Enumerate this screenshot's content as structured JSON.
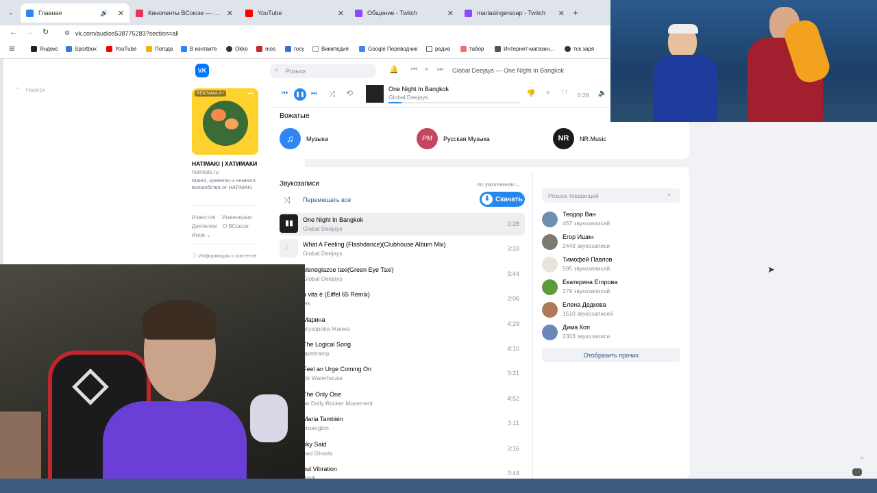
{
  "browser": {
    "tabs": [
      {
        "title": "Главная",
        "color": "#2787f5"
      },
      {
        "title": "Киноленты ВСоюзе — смотр…",
        "color": "#e8345c"
      },
      {
        "title": "YouTube",
        "color": "#ff0000"
      },
      {
        "title": "Общение - Twitch",
        "color": "#9146ff"
      },
      {
        "title": "marlasingersoap - Twitch",
        "color": "#9146ff"
      }
    ],
    "url": "vk.com/audios538775283?section=all",
    "bookmarks": [
      "Яндекс",
      "Sportbox",
      "YouTube",
      "Погода",
      "В контакте",
      "Okko",
      "mos",
      "госу",
      "Википедия",
      "Google Переводчик",
      "радио",
      "табор",
      "Интернет-магазин...",
      "тск заря"
    ]
  },
  "header": {
    "logo": "VK",
    "search_placeholder": "Розыск",
    "now_playing": "Global Deejays — One Night In Bangkok"
  },
  "left_nav": {
    "back_label": "Наверх"
  },
  "ad": {
    "badge": "РЕКЛАМА 0+",
    "title": "HATIMAKI | ХАТИМАКИ",
    "domain": "hatimaki.ru",
    "text": "Манго, креветки и немного волшебства от HATIMAKI",
    "footer_links": [
      "Известия",
      "Инженерам",
      "Деятелям",
      "О ВСоюзе",
      "Иное"
    ],
    "content_info": "Информация о контенте"
  },
  "player": {
    "track_title": "One Night In Bangkok",
    "track_artist": "Global Deejays",
    "time": "0:28",
    "progress": 0.1
  },
  "curators": {
    "title": "Вожатые",
    "items": [
      {
        "name": "Музыка",
        "bg": "#2f86f0",
        "glyph": "♫"
      },
      {
        "name": "Русская Музыка",
        "bg": "#c6455f",
        "glyph": "РМ"
      },
      {
        "name": "NR.Music",
        "bg": "#1a1a1a",
        "glyph": "NR"
      }
    ]
  },
  "audios": {
    "title": "Звукозаписи",
    "sort": "по умолчанию",
    "shuffle_label": "Перемешать все",
    "download_label": "Скачать",
    "tracks": [
      {
        "title": "One Night In Bangkok",
        "artist": "Global Deejays",
        "duration": "0:28"
      },
      {
        "title": "What A Feeling (Flashdance)(Clubhouse Album Mix)",
        "artist": "Global Deejays",
        "duration": "3:33"
      },
      {
        "title": "elenoglazoe taxi(Green Eye Taxi)",
        "artist": "Global Deejays",
        "duration": "3:44"
      },
      {
        "title": "a vita è (Eiffel 65 Remix)",
        "artist": "iek",
        "duration": "3:06"
      },
      {
        "title": "Марина",
        "artist": "агузарова Жанна",
        "duration": "4:29"
      },
      {
        "title": "The Logical Song",
        "artist": "upertramp",
        "duration": "4:10"
      },
      {
        "title": "Feel an Urge Coming On",
        "artist": "ick Waterhouse",
        "duration": "3:21"
      },
      {
        "title": "The Only One",
        "artist": "he Dolly Rocker Movement",
        "duration": "4:52"
      },
      {
        "title": "Maria También",
        "artist": "hruangbin",
        "duration": "3:11"
      },
      {
        "title": "oky Said",
        "artist": "ead Ghosts",
        "duration": "3:16"
      },
      {
        "title": "oul Vibration",
        "artist": "Walk",
        "duration": "3:44"
      }
    ]
  },
  "friends": {
    "search_placeholder": "Розыск товарищей",
    "items": [
      {
        "name": "Теодор Ван",
        "count": "457 звукозаписей",
        "color": "#6d8fb0"
      },
      {
        "name": "Егор Ишин",
        "count": "2443 звукозаписи",
        "color": "#7a7a70"
      },
      {
        "name": "Тимофей Павлов",
        "count": "595 звукозаписей",
        "color": "#e8e4dc"
      },
      {
        "name": "Екатерина Егорова",
        "count": "279 звукозаписей",
        "color": "#5d9a3c"
      },
      {
        "name": "Елена Дедкова",
        "count": "1510 звукозаписей",
        "color": "#b07a58"
      },
      {
        "name": "Дима Коп",
        "count": "2303 звукозаписи",
        "color": "#6a88b8"
      }
    ],
    "show_more": "Отобразить прочих"
  }
}
